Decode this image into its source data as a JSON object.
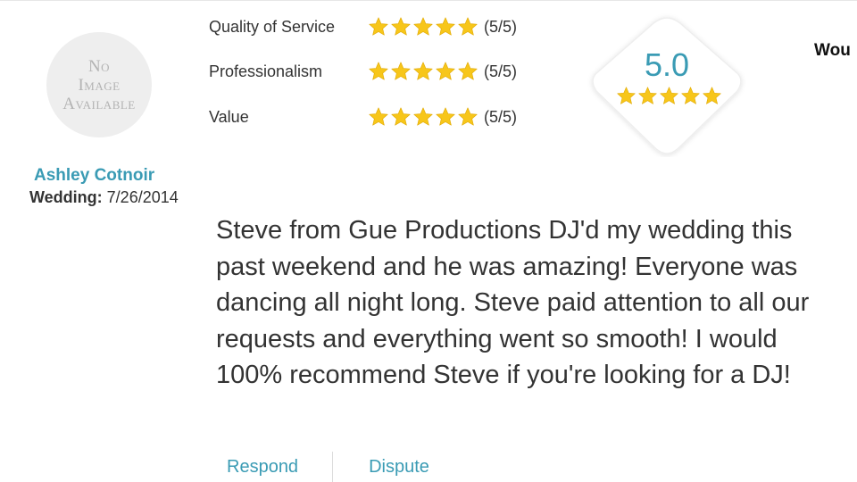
{
  "colors": {
    "accent": "#3a9bb4",
    "star": "#f7c61a",
    "text": "#333333"
  },
  "reviewer": {
    "avatar_text": [
      "No",
      "Image",
      "Available"
    ],
    "name": "Ashley Cotnoir",
    "wedding_label": "Wedding:",
    "wedding_date": "7/26/2014"
  },
  "ratings": [
    {
      "label": "Quality of Service",
      "stars": 5,
      "score": "(5/5)"
    },
    {
      "label": "Professionalism",
      "stars": 5,
      "score": "(5/5)"
    },
    {
      "label": "Value",
      "stars": 5,
      "score": "(5/5)"
    }
  ],
  "overall": {
    "score": "5.0",
    "stars": 5
  },
  "side_text": "Wou",
  "review": {
    "text": "Steve from Gue Productions DJ'd my wedding this past weekend and he was amazing! Everyone was dancing all night long. Steve paid attention to all our requests and everything went so smooth! I would 100% recommend Steve if you're looking for a DJ!"
  },
  "actions": {
    "respond": "Respond",
    "dispute": "Dispute"
  }
}
